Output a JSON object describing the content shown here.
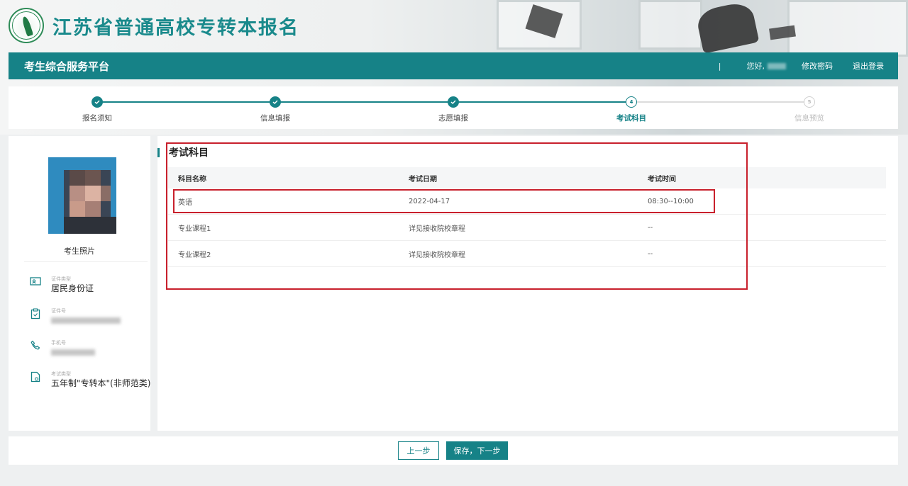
{
  "brand": {
    "title": "江苏省普通高校专转本报名"
  },
  "topbar": {
    "platform": "考生综合服务平台",
    "separator": "|",
    "greeting": "您好,",
    "change_password": "修改密码",
    "logout": "退出登录"
  },
  "steps": [
    {
      "label": "报名须知",
      "state": "done",
      "mark": ""
    },
    {
      "label": "信息填报",
      "state": "done",
      "mark": ""
    },
    {
      "label": "志愿填报",
      "state": "done",
      "mark": ""
    },
    {
      "label": "考试科目",
      "state": "current",
      "mark": "4"
    },
    {
      "label": "信息预览",
      "state": "todo",
      "mark": "5"
    }
  ],
  "profile": {
    "photo_label": "考生照片",
    "id_type_label": "证件类型",
    "id_type_value": "居民身份证",
    "id_no_label": "证件号",
    "phone_label": "手机号",
    "exam_type_label": "考试类型",
    "exam_type_value": "五年制\"专转本\"(非师范类)"
  },
  "main": {
    "section_title": "考试科目",
    "columns": [
      "科目名称",
      "考试日期",
      "考试时间"
    ],
    "rows": [
      [
        "英语",
        "2022-04-17",
        "08:30--10:00"
      ],
      [
        "专业课程1",
        "详见接收院校章程",
        "--"
      ],
      [
        "专业课程2",
        "详见接收院校章程",
        "--"
      ]
    ]
  },
  "footer": {
    "prev_label": "上一步",
    "next_label": "保存，下一步"
  },
  "colors": {
    "primary": "#168287",
    "annotation_red": "#c8202c"
  }
}
